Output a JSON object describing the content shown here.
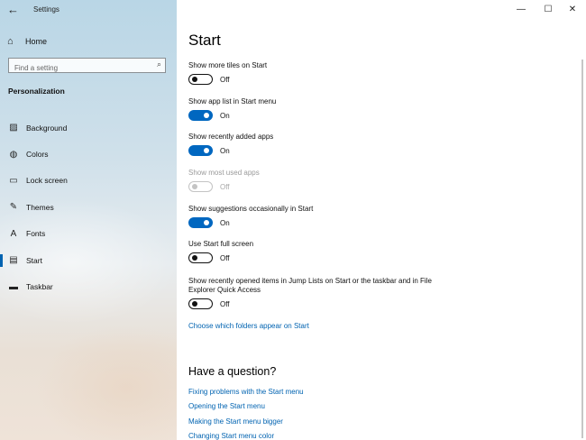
{
  "app": {
    "title": "Settings"
  },
  "window": {
    "minimize": "—",
    "maximize": "☐",
    "close": "✕"
  },
  "sidebar": {
    "home_label": "Home",
    "search_placeholder": "Find a setting",
    "section": "Personalization",
    "items": [
      {
        "label": "Background",
        "icon": "picture-icon",
        "glyph": "▨"
      },
      {
        "label": "Colors",
        "icon": "palette-icon",
        "glyph": "◍"
      },
      {
        "label": "Lock screen",
        "icon": "lock-screen-icon",
        "glyph": "▭"
      },
      {
        "label": "Themes",
        "icon": "themes-icon",
        "glyph": "✎"
      },
      {
        "label": "Fonts",
        "icon": "fonts-icon",
        "glyph": "A"
      },
      {
        "label": "Start",
        "icon": "start-icon",
        "glyph": "▤",
        "active": true
      },
      {
        "label": "Taskbar",
        "icon": "taskbar-icon",
        "glyph": "▬"
      }
    ]
  },
  "main": {
    "title": "Start",
    "settings": [
      {
        "label": "Show more tiles on Start",
        "state": "Off"
      },
      {
        "label": "Show app list in Start menu",
        "state": "On"
      },
      {
        "label": "Show recently added apps",
        "state": "On"
      },
      {
        "label": "Show most used apps",
        "state": "Off",
        "disabled": true
      },
      {
        "label": "Show suggestions occasionally in Start",
        "state": "On"
      },
      {
        "label": "Use Start full screen",
        "state": "Off"
      },
      {
        "label": "Show recently opened items in Jump Lists on Start or the taskbar and in File Explorer Quick Access",
        "state": "Off"
      }
    ],
    "folders_link": "Choose which folders appear on Start",
    "question_title": "Have a question?",
    "help_links": [
      "Fixing problems with the Start menu",
      "Opening the Start menu",
      "Making the Start menu bigger",
      "Changing Start menu color"
    ]
  }
}
